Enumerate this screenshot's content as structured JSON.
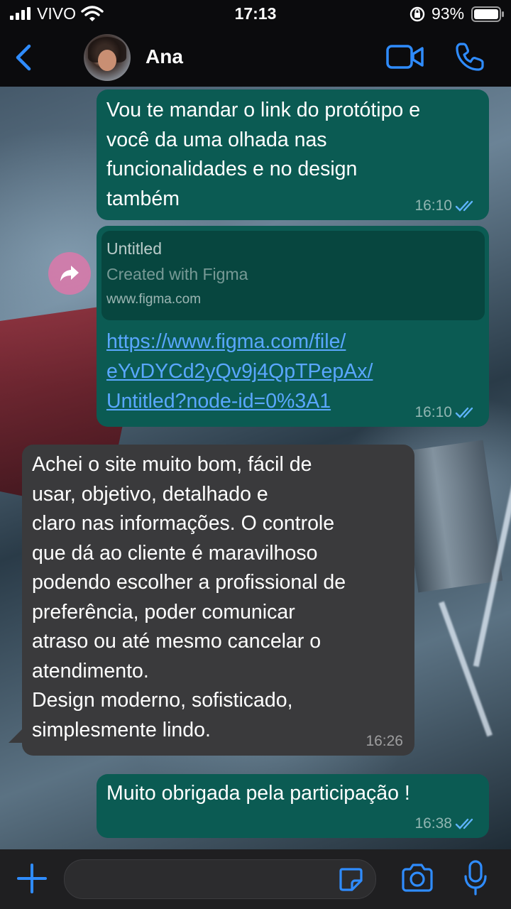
{
  "status_bar": {
    "carrier": "VIVO",
    "time": "17:13",
    "battery": "93%"
  },
  "header": {
    "contact_name": "Ana"
  },
  "messages": [
    {
      "direction": "outgoing",
      "text": "Vou te mandar o link do protótipo e\nvocê da uma olhada nas\nfuncionalidades e no design\ntambém",
      "time": "16:10",
      "status": "read"
    },
    {
      "direction": "outgoing",
      "preview": {
        "title": "Untitled",
        "description": "Created with Figma",
        "domain": "www.figma.com"
      },
      "link": "https://www.figma.com/file/\neYvDYCd2yQv9j4QpTPepAx/\nUntitled?node-id=0%3A1",
      "time": "16:10",
      "status": "read"
    },
    {
      "direction": "incoming",
      "text": "Achei o site muito bom, fácil de\nusar, objetivo, detalhado e\nclaro nas informações. O controle\nque dá ao cliente é maravilhoso\npodendo escolher a profissional de\npreferência, poder comunicar\natraso ou até mesmo cancelar o\natendimento.\nDesign moderno, sofisticado,\nsimplesmente lindo.",
      "time": "16:26"
    },
    {
      "direction": "outgoing",
      "text": "Muito obrigada pela participação !",
      "time": "16:38",
      "status": "read"
    }
  ],
  "colors": {
    "accent": "#2f8cff",
    "outgoing_bubble": "#0b5b53",
    "incoming_bubble": "#3a3a3c",
    "link": "#5aa7ff",
    "read_tick": "#5fb4ff"
  },
  "icons": [
    "back-chevron-icon",
    "video-camera-icon",
    "phone-icon",
    "forward-icon",
    "plus-icon",
    "sticker-icon",
    "camera-icon",
    "microphone-icon"
  ]
}
